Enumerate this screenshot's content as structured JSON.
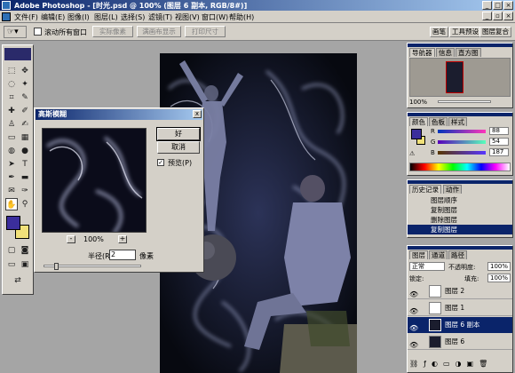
{
  "app": {
    "window_title": "Adobe Photoshop - [时光.psd @ 100% (图层 6 副本, RGB/8#)]"
  },
  "menu": {
    "items": [
      "文件(F)",
      "编辑(E)",
      "图像(I)",
      "图层(L)",
      "选择(S)",
      "滤镜(T)",
      "视图(V)",
      "窗口(W)",
      "帮助(H)"
    ]
  },
  "options_bar": {
    "scroll_all_label": "滚动所有窗口",
    "buttons": [
      "实际像素",
      "满画布显示",
      "打印尺寸"
    ],
    "wells": [
      "画笔",
      "工具预设",
      "图层复合"
    ]
  },
  "dialog": {
    "title": "高斯模糊",
    "ok": "好",
    "cancel": "取消",
    "preview_label": "预览(P)",
    "preview_checked": "✓",
    "zoom": "100%",
    "zoom_minus": "-",
    "zoom_plus": "+",
    "radius_label": "半径(R):",
    "radius_value": "2",
    "radius_unit": "像素",
    "close": "x"
  },
  "navigator": {
    "tabs": [
      "导航器",
      "信息",
      "直方图"
    ],
    "zoom": "100%"
  },
  "color_panel": {
    "tabs": [
      "颜色",
      "色板",
      "样式"
    ],
    "channels": [
      {
        "label": "R",
        "value": "88",
        "color": "#c00000"
      },
      {
        "label": "G",
        "value": "54",
        "color": "#00a000"
      },
      {
        "label": "B",
        "value": "187",
        "color": "#0000c0"
      }
    ],
    "foreground": "#3b2e9c",
    "background": "#f1e17a"
  },
  "history_panel": {
    "tabs": [
      "历史记录",
      "动作"
    ],
    "items": [
      "图层顺序",
      "复制图层",
      "删除图层",
      "复制图层"
    ]
  },
  "layers_panel": {
    "tabs": [
      "图层",
      "通道",
      "路径"
    ],
    "blend_mode": "正常",
    "opacity_label": "不透明度:",
    "opacity_value": "100%",
    "lock_label": "锁定:",
    "fill_label": "填充:",
    "fill_value": "100%",
    "layers": [
      {
        "name": "图层 2",
        "selected": false
      },
      {
        "name": "图层 1",
        "selected": false
      },
      {
        "name": "图层 6 副本",
        "selected": true
      },
      {
        "name": "图层 6",
        "selected": false
      }
    ]
  },
  "colors": {
    "title_blue": "#0a246a",
    "panel_grey": "#d4d0c8",
    "workspace": "#a5a5a5",
    "selection": "#0a246a"
  }
}
